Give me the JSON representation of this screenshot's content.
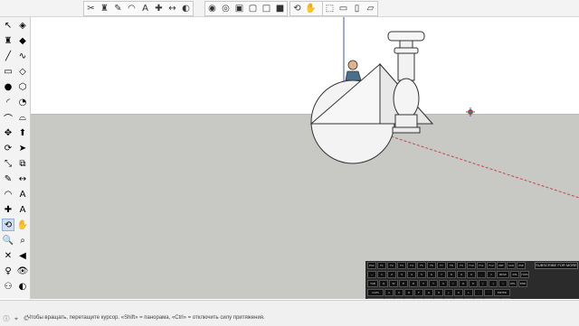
{
  "toolbar": {
    "groups": [
      {
        "name": "standard",
        "icons": [
          "cut-icon",
          "paint-bucket-icon",
          "tape-measure-icon",
          "protractor-icon",
          "text-icon",
          "axes-icon",
          "dimension-icon",
          "section-plane-icon"
        ]
      },
      {
        "name": "views",
        "icons": [
          "styles-icon",
          "xray-icon",
          "back-edges-icon",
          "wireframe-icon",
          "hidden-line-icon",
          "shaded-icon"
        ]
      },
      {
        "name": "camera",
        "icons": [
          "orbit-icon",
          "pan-icon",
          "zoom-icon",
          "zoom-window-icon",
          "zoom-extents-icon",
          "previous-view-icon"
        ]
      },
      {
        "name": "scenes",
        "icons": [
          "iso-view-icon",
          "top-view-icon",
          "front-view-icon",
          "right-view-icon"
        ]
      }
    ]
  },
  "left_tools": [
    {
      "name": "select-tool",
      "glyph": "↖"
    },
    {
      "name": "component-tool",
      "glyph": "◈"
    },
    {
      "name": "paint-bucket-tool",
      "glyph": "♜"
    },
    {
      "name": "eraser-tool",
      "glyph": "◆"
    },
    {
      "name": "line-tool",
      "glyph": "╱"
    },
    {
      "name": "freehand-tool",
      "glyph": "∿"
    },
    {
      "name": "rectangle-tool",
      "glyph": "▭"
    },
    {
      "name": "rotated-rectangle-tool",
      "glyph": "◇"
    },
    {
      "name": "circle-tool",
      "glyph": "●"
    },
    {
      "name": "polygon-tool",
      "glyph": "⬡"
    },
    {
      "name": "arc-tool",
      "glyph": "◜"
    },
    {
      "name": "pie-tool",
      "glyph": "◔"
    },
    {
      "name": "three-point-arc-tool",
      "glyph": "⌒"
    },
    {
      "name": "two-point-arc-tool",
      "glyph": "⌓"
    },
    {
      "name": "move-tool",
      "glyph": "✥"
    },
    {
      "name": "push-pull-tool",
      "glyph": "⬆"
    },
    {
      "name": "rotate-tool",
      "glyph": "⟳"
    },
    {
      "name": "follow-me-tool",
      "glyph": "➤"
    },
    {
      "name": "scale-tool",
      "glyph": "⤡"
    },
    {
      "name": "offset-tool",
      "glyph": "⧉"
    },
    {
      "name": "tape-measure-tool",
      "glyph": "✎"
    },
    {
      "name": "dimension-tool",
      "glyph": "↔"
    },
    {
      "name": "protractor-tool",
      "glyph": "◠"
    },
    {
      "name": "text-tool",
      "glyph": "A"
    },
    {
      "name": "axes-tool",
      "glyph": "✚"
    },
    {
      "name": "3d-text-tool",
      "glyph": "A"
    },
    {
      "name": "orbit-tool",
      "glyph": "⟲",
      "active": true
    },
    {
      "name": "pan-tool",
      "glyph": "✋"
    },
    {
      "name": "zoom-tool",
      "glyph": "🔍"
    },
    {
      "name": "zoom-window-tool",
      "glyph": "⌕"
    },
    {
      "name": "zoom-extents-tool",
      "glyph": "✕"
    },
    {
      "name": "previous-tool",
      "glyph": "◀"
    },
    {
      "name": "position-camera-tool",
      "glyph": "♀"
    },
    {
      "name": "look-around-tool",
      "glyph": "👁"
    },
    {
      "name": "walk-tool",
      "glyph": "⚇"
    },
    {
      "name": "section-plane-tool",
      "glyph": "◐"
    }
  ],
  "status": {
    "text": "Чтобы вращать, перетащите курсор. «Shift» = панорама, «Ctrl» = отключить силу притяжения.",
    "icons": [
      "info-icon",
      "geo-location-icon",
      "credits-icon"
    ]
  },
  "keyboard": {
    "subscribe_label": "SUBSCRIBE FOR MORE",
    "rows": [
      [
        "ESC",
        "F1",
        "F2",
        "F3",
        "F4",
        "F5",
        "F6",
        "F7",
        "F8",
        "F9",
        "F10",
        "F11",
        "F12",
        "PRT",
        "SCR",
        "PSE"
      ],
      [
        "~",
        "1",
        "2",
        "3",
        "4",
        "5",
        "6",
        "7",
        "8",
        "9",
        "0",
        "-",
        "=",
        "BKSP",
        "INS",
        "HOM"
      ],
      [
        "TAB",
        "Q",
        "W",
        "E",
        "R",
        "T",
        "Y",
        "U",
        "I",
        "O",
        "P",
        "[",
        "]",
        "\\",
        "DEL",
        "END"
      ],
      [
        "CAPS LOCK",
        "A",
        "S",
        "D",
        "F",
        "G",
        "H",
        "J",
        "K",
        "L",
        ";",
        "'",
        "ENTER"
      ],
      [
        "SHIFT",
        "Z",
        "X",
        "C",
        "V",
        "B",
        "N",
        "M",
        ",",
        ".",
        "/",
        "SHIFT",
        "↑"
      ],
      [
        "CTRL",
        "WIN",
        "ALT",
        "SPACE",
        "ALT",
        "MENU",
        "CTRL",
        "←",
        "↓",
        "→"
      ]
    ],
    "highlighted": [
      "CTRL"
    ]
  },
  "colors": {
    "sky": "#ffffff",
    "ground": "#c8c9c5",
    "axis_blue": "#3b56b8",
    "axis_red": "#c0474b",
    "model_fill": "#f2f2f2",
    "active_tool": "#cfe0f3"
  }
}
